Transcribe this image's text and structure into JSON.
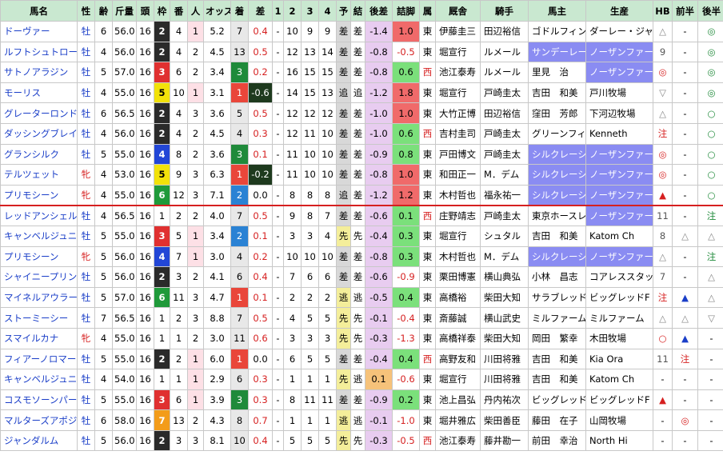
{
  "headers": [
    "馬名",
    "性",
    "齢",
    "斤量",
    "頭",
    "枠",
    "番",
    "人",
    "オッズ",
    "着",
    "差",
    "1",
    "2",
    "3",
    "4",
    "予",
    "結",
    "後差",
    "詰脚",
    "属",
    "厩舎",
    "騎手",
    "馬主",
    "生産",
    "HB",
    "前半",
    "後半"
  ],
  "rows": [
    {
      "name": "ドーヴァー",
      "sex": "牡",
      "age": "6",
      "weight": "56.0",
      "n": "16",
      "waku": "2",
      "ban": "4",
      "pop": "1",
      "odds": "5.2",
      "rank": "7",
      "diff": "0.4",
      "c1": "-",
      "c2": "10",
      "c3": "9",
      "c4": "9",
      "yo": "差",
      "ke": "差",
      "atosa": "-1.4",
      "tsume": "1.0",
      "zoku": "東",
      "stable": "伊藤圭三",
      "jockey": "田辺裕信",
      "owner": "ゴドルフィン",
      "breeder": "ダーレー・ジャパ",
      "hb": "△",
      "zen": "-",
      "kou": "◎"
    },
    {
      "name": "ルフトシュトローム",
      "sex": "牡",
      "age": "4",
      "weight": "56.0",
      "n": "16",
      "waku": "2",
      "ban": "4",
      "pop": "2",
      "odds": "4.5",
      "rank": "13",
      "diff": "0.5",
      "c1": "-",
      "c2": "12",
      "c3": "13",
      "c4": "14",
      "yo": "差",
      "ke": "差",
      "atosa": "-0.8",
      "tsume": "-0.5",
      "zoku": "東",
      "stable": "堀宣行",
      "jockey": "ルメール",
      "owner": "サンデーレー",
      "breeder": "ノーザンファーム",
      "hb": "9",
      "zen": "-",
      "kou": "◎"
    },
    {
      "name": "サトノアラジン",
      "sex": "牡",
      "age": "5",
      "weight": "57.0",
      "n": "16",
      "waku": "3",
      "ban": "6",
      "pop": "2",
      "odds": "3.4",
      "rank": "3",
      "diff": "0.2",
      "c1": "-",
      "c2": "16",
      "c3": "15",
      "c4": "15",
      "yo": "差",
      "ke": "差",
      "atosa": "-0.8",
      "tsume": "0.6",
      "zoku": "西",
      "stable": "池江泰寿",
      "jockey": "ルメール",
      "owner": "里見　治",
      "breeder": "ノーザンファーム",
      "hb": "◎",
      "zen": "-",
      "kou": "◎"
    },
    {
      "name": "モーリス",
      "sex": "牡",
      "age": "4",
      "weight": "55.0",
      "n": "16",
      "waku": "5",
      "ban": "10",
      "pop": "1",
      "odds": "3.1",
      "rank": "1",
      "diff": "-0.6",
      "c1": "-",
      "c2": "14",
      "c3": "15",
      "c4": "13",
      "yo": "追",
      "ke": "追",
      "atosa": "-1.2",
      "tsume": "1.8",
      "zoku": "東",
      "stable": "堀宣行",
      "jockey": "戸崎圭太",
      "owner": "吉田　和美",
      "breeder": "戸川牧場",
      "hb": "▽",
      "zen": "-",
      "kou": "◎"
    },
    {
      "name": "グレーターロンドン",
      "sex": "牡",
      "age": "6",
      "weight": "56.5",
      "n": "16",
      "waku": "2",
      "ban": "4",
      "pop": "3",
      "odds": "3.6",
      "rank": "5",
      "diff": "0.5",
      "c1": "-",
      "c2": "12",
      "c3": "12",
      "c4": "12",
      "yo": "差",
      "ke": "差",
      "atosa": "-1.0",
      "tsume": "1.0",
      "zoku": "東",
      "stable": "大竹正博",
      "jockey": "田辺裕信",
      "owner": "窪田　芳郎",
      "breeder": "下河辺牧場",
      "hb": "△",
      "zen": "-",
      "kou": "○"
    },
    {
      "name": "ダッシングブレイズ",
      "sex": "牡",
      "age": "4",
      "weight": "56.0",
      "n": "16",
      "waku": "2",
      "ban": "4",
      "pop": "2",
      "odds": "4.5",
      "rank": "4",
      "diff": "0.3",
      "c1": "-",
      "c2": "12",
      "c3": "11",
      "c4": "10",
      "yo": "差",
      "ke": "差",
      "atosa": "-1.0",
      "tsume": "0.6",
      "zoku": "西",
      "stable": "吉村圭司",
      "jockey": "戸崎圭太",
      "owner": "グリーンフィ",
      "breeder": "Kenneth",
      "hb": "注",
      "zen": "-",
      "kou": "○"
    },
    {
      "name": "グランシルク",
      "sex": "牡",
      "age": "5",
      "weight": "55.0",
      "n": "16",
      "waku": "4",
      "ban": "8",
      "pop": "2",
      "odds": "3.6",
      "rank": "3",
      "diff": "0.1",
      "c1": "-",
      "c2": "11",
      "c3": "10",
      "c4": "10",
      "yo": "差",
      "ke": "差",
      "atosa": "-0.9",
      "tsume": "0.8",
      "zoku": "東",
      "stable": "戸田博文",
      "jockey": "戸崎圭太",
      "owner": "シルクレーシ",
      "breeder": "ノーザンファーム",
      "hb": "◎",
      "zen": "-",
      "kou": "○"
    },
    {
      "name": "テルツェット",
      "sex": "牝",
      "age": "4",
      "weight": "53.0",
      "n": "16",
      "waku": "5",
      "ban": "9",
      "pop": "3",
      "odds": "6.3",
      "rank": "1",
      "diff": "-0.2",
      "c1": "-",
      "c2": "11",
      "c3": "10",
      "c4": "10",
      "yo": "差",
      "ke": "差",
      "atosa": "-0.8",
      "tsume": "1.0",
      "zoku": "東",
      "stable": "和田正一",
      "jockey": "M．デム",
      "owner": "シルクレーシ",
      "breeder": "ノーザンファーム",
      "hb": "◎",
      "zen": "-",
      "kou": "○"
    },
    {
      "name": "プリモシーン",
      "sex": "牝",
      "age": "4",
      "weight": "55.0",
      "n": "16",
      "waku": "6",
      "ban": "12",
      "pop": "3",
      "odds": "7.1",
      "rank": "2",
      "diff": "0.0",
      "c1": "-",
      "c2": "8",
      "c3": "8",
      "c4": "8",
      "yo": "追",
      "ke": "差",
      "atosa": "-1.2",
      "tsume": "1.2",
      "zoku": "東",
      "stable": "木村哲也",
      "jockey": "福永祐一",
      "owner": "シルクレーシ",
      "breeder": "ノーザンファーム",
      "hb": "▲",
      "zen": "-",
      "kou": "○"
    },
    {
      "name": "レッドアンシェル",
      "sex": "牡",
      "age": "4",
      "weight": "56.5",
      "n": "16",
      "waku": "1",
      "ban": "2",
      "pop": "2",
      "odds": "4.0",
      "rank": "7",
      "diff": "0.5",
      "c1": "-",
      "c2": "9",
      "c3": "8",
      "c4": "7",
      "yo": "差",
      "ke": "差",
      "atosa": "-0.6",
      "tsume": "0.1",
      "zoku": "西",
      "stable": "庄野靖志",
      "jockey": "戸崎圭太",
      "owner": "東京ホースレ",
      "breeder": "ノーザンファーム",
      "hb": "11",
      "zen": "-",
      "kou": "注"
    },
    {
      "name": "キャンベルジュニア",
      "sex": "牡",
      "age": "5",
      "weight": "55.0",
      "n": "16",
      "waku": "3",
      "ban": "5",
      "pop": "1",
      "odds": "3.4",
      "rank": "2",
      "diff": "0.1",
      "c1": "-",
      "c2": "3",
      "c3": "3",
      "c4": "4",
      "yo": "先",
      "ke": "先",
      "atosa": "-0.4",
      "tsume": "0.3",
      "zoku": "東",
      "stable": "堀宣行",
      "jockey": "シュタル",
      "owner": "吉田　和美",
      "breeder": "Katom Ch",
      "hb": "8",
      "zen": "△",
      "kou": "△"
    },
    {
      "name": "プリモシーン",
      "sex": "牝",
      "age": "5",
      "weight": "56.0",
      "n": "16",
      "waku": "4",
      "ban": "7",
      "pop": "1",
      "odds": "3.0",
      "rank": "4",
      "diff": "0.2",
      "c1": "-",
      "c2": "10",
      "c3": "10",
      "c4": "10",
      "yo": "差",
      "ke": "差",
      "atosa": "-0.8",
      "tsume": "0.3",
      "zoku": "東",
      "stable": "木村哲也",
      "jockey": "M．デム",
      "owner": "シルクレーシ",
      "breeder": "ノーザンファーム",
      "hb": "△",
      "zen": "-",
      "kou": "注"
    },
    {
      "name": "シャイニープリンス",
      "sex": "牡",
      "age": "5",
      "weight": "56.0",
      "n": "16",
      "waku": "2",
      "ban": "3",
      "pop": "2",
      "odds": "4.1",
      "rank": "6",
      "diff": "0.4",
      "c1": "-",
      "c2": "7",
      "c3": "6",
      "c4": "6",
      "yo": "差",
      "ke": "差",
      "atosa": "-0.6",
      "tsume": "-0.9",
      "zoku": "東",
      "stable": "栗田博憲",
      "jockey": "横山典弘",
      "owner": "小林　昌志",
      "breeder": "コアレススタッド",
      "hb": "7",
      "zen": "-",
      "kou": "△"
    },
    {
      "name": "マイネルアウラート",
      "sex": "牡",
      "age": "5",
      "weight": "57.0",
      "n": "16",
      "waku": "6",
      "ban": "11",
      "pop": "3",
      "odds": "4.7",
      "rank": "1",
      "diff": "0.1",
      "c1": "-",
      "c2": "2",
      "c3": "2",
      "c4": "2",
      "yo": "逃",
      "ke": "逃",
      "atosa": "-0.5",
      "tsume": "0.4",
      "zoku": "東",
      "stable": "高橋裕",
      "jockey": "柴田大知",
      "owner": "サラブレッド",
      "breeder": "ビッグレッドF",
      "hb": "注",
      "zen": "▲",
      "kou": "△"
    },
    {
      "name": "ストーミーシー",
      "sex": "牡",
      "age": "7",
      "weight": "56.5",
      "n": "16",
      "waku": "1",
      "ban": "2",
      "pop": "3",
      "odds": "8.8",
      "rank": "7",
      "diff": "0.5",
      "c1": "-",
      "c2": "4",
      "c3": "5",
      "c4": "5",
      "yo": "先",
      "ke": "先",
      "atosa": "-0.1",
      "tsume": "-0.4",
      "zoku": "東",
      "stable": "斎藤誠",
      "jockey": "横山武史",
      "owner": "ミルファーム",
      "breeder": "ミルファーム",
      "hb": "△",
      "zen": "△",
      "kou": "▽"
    },
    {
      "name": "スマイルカナ",
      "sex": "牝",
      "age": "4",
      "weight": "55.0",
      "n": "16",
      "waku": "1",
      "ban": "1",
      "pop": "2",
      "odds": "3.0",
      "rank": "11",
      "diff": "0.6",
      "c1": "-",
      "c2": "3",
      "c3": "3",
      "c4": "3",
      "yo": "先",
      "ke": "先",
      "atosa": "-0.3",
      "tsume": "-1.3",
      "zoku": "東",
      "stable": "高橋祥泰",
      "jockey": "柴田大知",
      "owner": "岡田　繁幸",
      "breeder": "木田牧場",
      "hb": "○",
      "zen": "▲",
      "kou": "-"
    },
    {
      "name": "フィアーノロマーノ",
      "sex": "牡",
      "age": "5",
      "weight": "55.0",
      "n": "16",
      "waku": "2",
      "ban": "2",
      "pop": "1",
      "odds": "6.0",
      "rank": "1",
      "diff": "0.0",
      "c1": "-",
      "c2": "6",
      "c3": "5",
      "c4": "5",
      "yo": "差",
      "ke": "差",
      "atosa": "-0.4",
      "tsume": "0.4",
      "zoku": "西",
      "stable": "高野友和",
      "jockey": "川田将雅",
      "owner": "吉田　和美",
      "breeder": "Kia Ora",
      "hb": "11",
      "zen": "注",
      "kou": "-"
    },
    {
      "name": "キャンベルジュニア",
      "sex": "牡",
      "age": "4",
      "weight": "54.0",
      "n": "16",
      "waku": "1",
      "ban": "1",
      "pop": "1",
      "odds": "2.9",
      "rank": "6",
      "diff": "0.3",
      "c1": "-",
      "c2": "1",
      "c3": "1",
      "c4": "1",
      "yo": "先",
      "ke": "逃",
      "atosa": "0.1",
      "tsume": "-0.6",
      "zoku": "東",
      "stable": "堀宣行",
      "jockey": "川田将雅",
      "owner": "吉田　和美",
      "breeder": "Katom Ch",
      "hb": "-",
      "zen": "-",
      "kou": "-"
    },
    {
      "name": "コスモソーンパーク",
      "sex": "牡",
      "age": "5",
      "weight": "55.0",
      "n": "16",
      "waku": "3",
      "ban": "6",
      "pop": "1",
      "odds": "3.9",
      "rank": "3",
      "diff": "0.3",
      "c1": "-",
      "c2": "8",
      "c3": "11",
      "c4": "11",
      "yo": "差",
      "ke": "差",
      "atosa": "-0.9",
      "tsume": "0.2",
      "zoku": "東",
      "stable": "池上昌弘",
      "jockey": "丹内祐次",
      "owner": "ビッグレッド",
      "breeder": "ビッグレッドF",
      "hb": "▲",
      "zen": "-",
      "kou": "-"
    },
    {
      "name": "マルターズアポジー",
      "sex": "牡",
      "age": "6",
      "weight": "58.0",
      "n": "16",
      "waku": "7",
      "ban": "13",
      "pop": "2",
      "odds": "4.3",
      "rank": "8",
      "diff": "0.7",
      "c1": "-",
      "c2": "1",
      "c3": "1",
      "c4": "1",
      "yo": "逃",
      "ke": "逃",
      "atosa": "-0.1",
      "tsume": "-1.0",
      "zoku": "東",
      "stable": "堀井雅広",
      "jockey": "柴田善臣",
      "owner": "藤田　在子",
      "breeder": "山岡牧場",
      "hb": "-",
      "zen": "◎",
      "kou": "-"
    },
    {
      "name": "ジャンダルム",
      "sex": "牡",
      "age": "5",
      "weight": "56.0",
      "n": "16",
      "waku": "2",
      "ban": "3",
      "pop": "3",
      "odds": "8.1",
      "rank": "10",
      "diff": "0.4",
      "c1": "-",
      "c2": "5",
      "c3": "5",
      "c4": "5",
      "yo": "先",
      "ke": "先",
      "atosa": "-0.3",
      "tsume": "-0.5",
      "zoku": "西",
      "stable": "池江泰寿",
      "jockey": "藤井勘一",
      "owner": "前田　幸治",
      "breeder": "North Hi",
      "hb": "-",
      "zen": "-",
      "kou": "-"
    }
  ],
  "colors": {
    "header_bg": "#c9e8d0",
    "separator": "#d62020",
    "purple": "#8a8cf2",
    "link_blue": "#1a3ec8"
  }
}
